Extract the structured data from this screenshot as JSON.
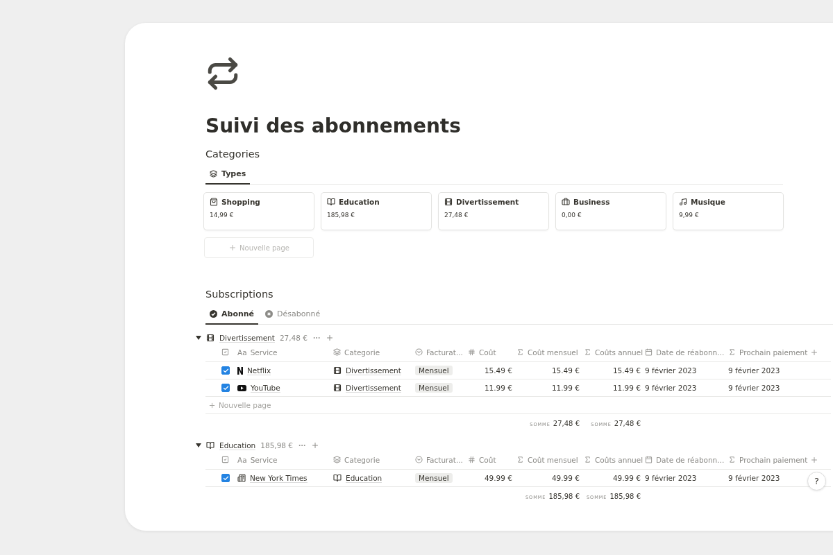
{
  "page": {
    "title": "Suivi des abonnements"
  },
  "categories": {
    "heading": "Categories",
    "tabs": [
      {
        "label": "Types",
        "selected": true
      }
    ],
    "cards": [
      {
        "name": "Shopping",
        "amount": "14,99 €"
      },
      {
        "name": "Education",
        "amount": "185,98 €"
      },
      {
        "name": "Divertissement",
        "amount": "27,48 €"
      },
      {
        "name": "Business",
        "amount": "0,00 €"
      },
      {
        "name": "Musique",
        "amount": "9,99 €"
      }
    ],
    "new_page": "Nouvelle page"
  },
  "subscriptions": {
    "heading": "Subscriptions",
    "tabs": [
      {
        "label": "Abonné",
        "selected": true
      },
      {
        "label": "Désabonné",
        "selected": false
      }
    ],
    "groups": [
      {
        "name": "Divertissement",
        "total": "27,48 €",
        "expanded": true,
        "columns": [
          {
            "prefix": "Aa",
            "label": "Service"
          },
          {
            "label": "Categorie"
          },
          {
            "label": "Facturat..."
          },
          {
            "label": "Coût"
          },
          {
            "label": "Coût mensuel"
          },
          {
            "label": "Coûts annuel"
          },
          {
            "label": "Date de réabonn..."
          },
          {
            "label": "Prochain paiement"
          }
        ],
        "rows": [
          {
            "checked": true,
            "service": "Netflix",
            "category": "Divertissement",
            "billing": "Mensuel",
            "cost": "15.49 €",
            "monthly": "15.49 €",
            "annual": "15.49 €",
            "renewal": "9 février 2023",
            "next": "9 février 2023"
          },
          {
            "checked": true,
            "service": "YouTube",
            "category": "Divertissement",
            "billing": "Mensuel",
            "cost": "11.99 €",
            "monthly": "11.99 €",
            "annual": "11.99 €",
            "renewal": "9 février 2023",
            "next": "9 février 2023"
          }
        ],
        "new_page": "Nouvelle page",
        "sums": [
          {
            "label": "SOMME",
            "value": "27,48 €"
          },
          {
            "label": "SOMME",
            "value": "27,48 €"
          }
        ]
      },
      {
        "name": "Education",
        "total": "185,98 €",
        "expanded": true,
        "columns": [
          {
            "prefix": "Aa",
            "label": "Service"
          },
          {
            "label": "Categorie"
          },
          {
            "label": "Facturat..."
          },
          {
            "label": "Coût"
          },
          {
            "label": "Coût mensuel"
          },
          {
            "label": "Coûts annuel"
          },
          {
            "label": "Date de réabonn..."
          },
          {
            "label": "Prochain paiement"
          }
        ],
        "rows": [
          {
            "checked": true,
            "service": "New York Times",
            "category": "Education",
            "billing": "Mensuel",
            "cost": "49.99 €",
            "monthly": "49.99 €",
            "annual": "49.99 €",
            "renewal": "9 février 2023",
            "next": "9 février 2023"
          }
        ],
        "sums": [
          {
            "label": "SOMME",
            "value": "185,98 €"
          },
          {
            "label": "SOMME",
            "value": "185,98 €"
          }
        ]
      }
    ]
  },
  "help": {
    "label": "?"
  }
}
